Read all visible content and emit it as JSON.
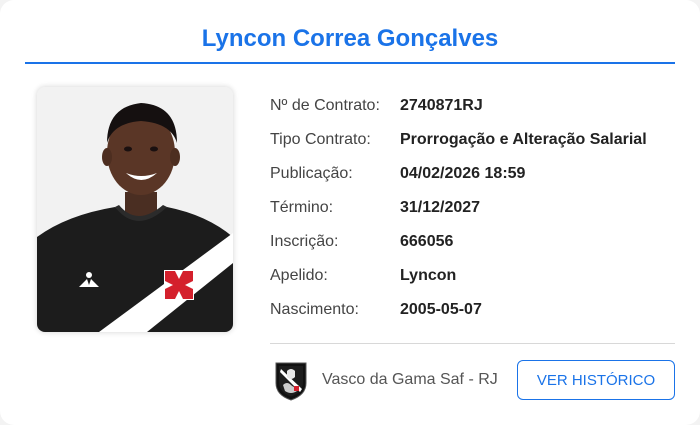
{
  "player": {
    "name": "Lyncon Correa Gonçalves"
  },
  "details": [
    {
      "label": "Nº de Contrato:",
      "value": "2740871RJ"
    },
    {
      "label": "Tipo Contrato:",
      "value": "Prorrogação e Alteração Salarial"
    },
    {
      "label": "Publicação:",
      "value": "04/02/2026 18:59"
    },
    {
      "label": "Término:",
      "value": "31/12/2027"
    },
    {
      "label": "Inscrição:",
      "value": "666056"
    },
    {
      "label": "Apelido:",
      "value": "Lyncon"
    },
    {
      "label": "Nascimento:",
      "value": "2005-05-07"
    }
  ],
  "club": {
    "name": "Vasco da Gama Saf - RJ",
    "crest_icon": "vasco-crest-icon"
  },
  "actions": {
    "history_label": "VER HISTÓRICO"
  },
  "colors": {
    "accent": "#1a73e8"
  }
}
